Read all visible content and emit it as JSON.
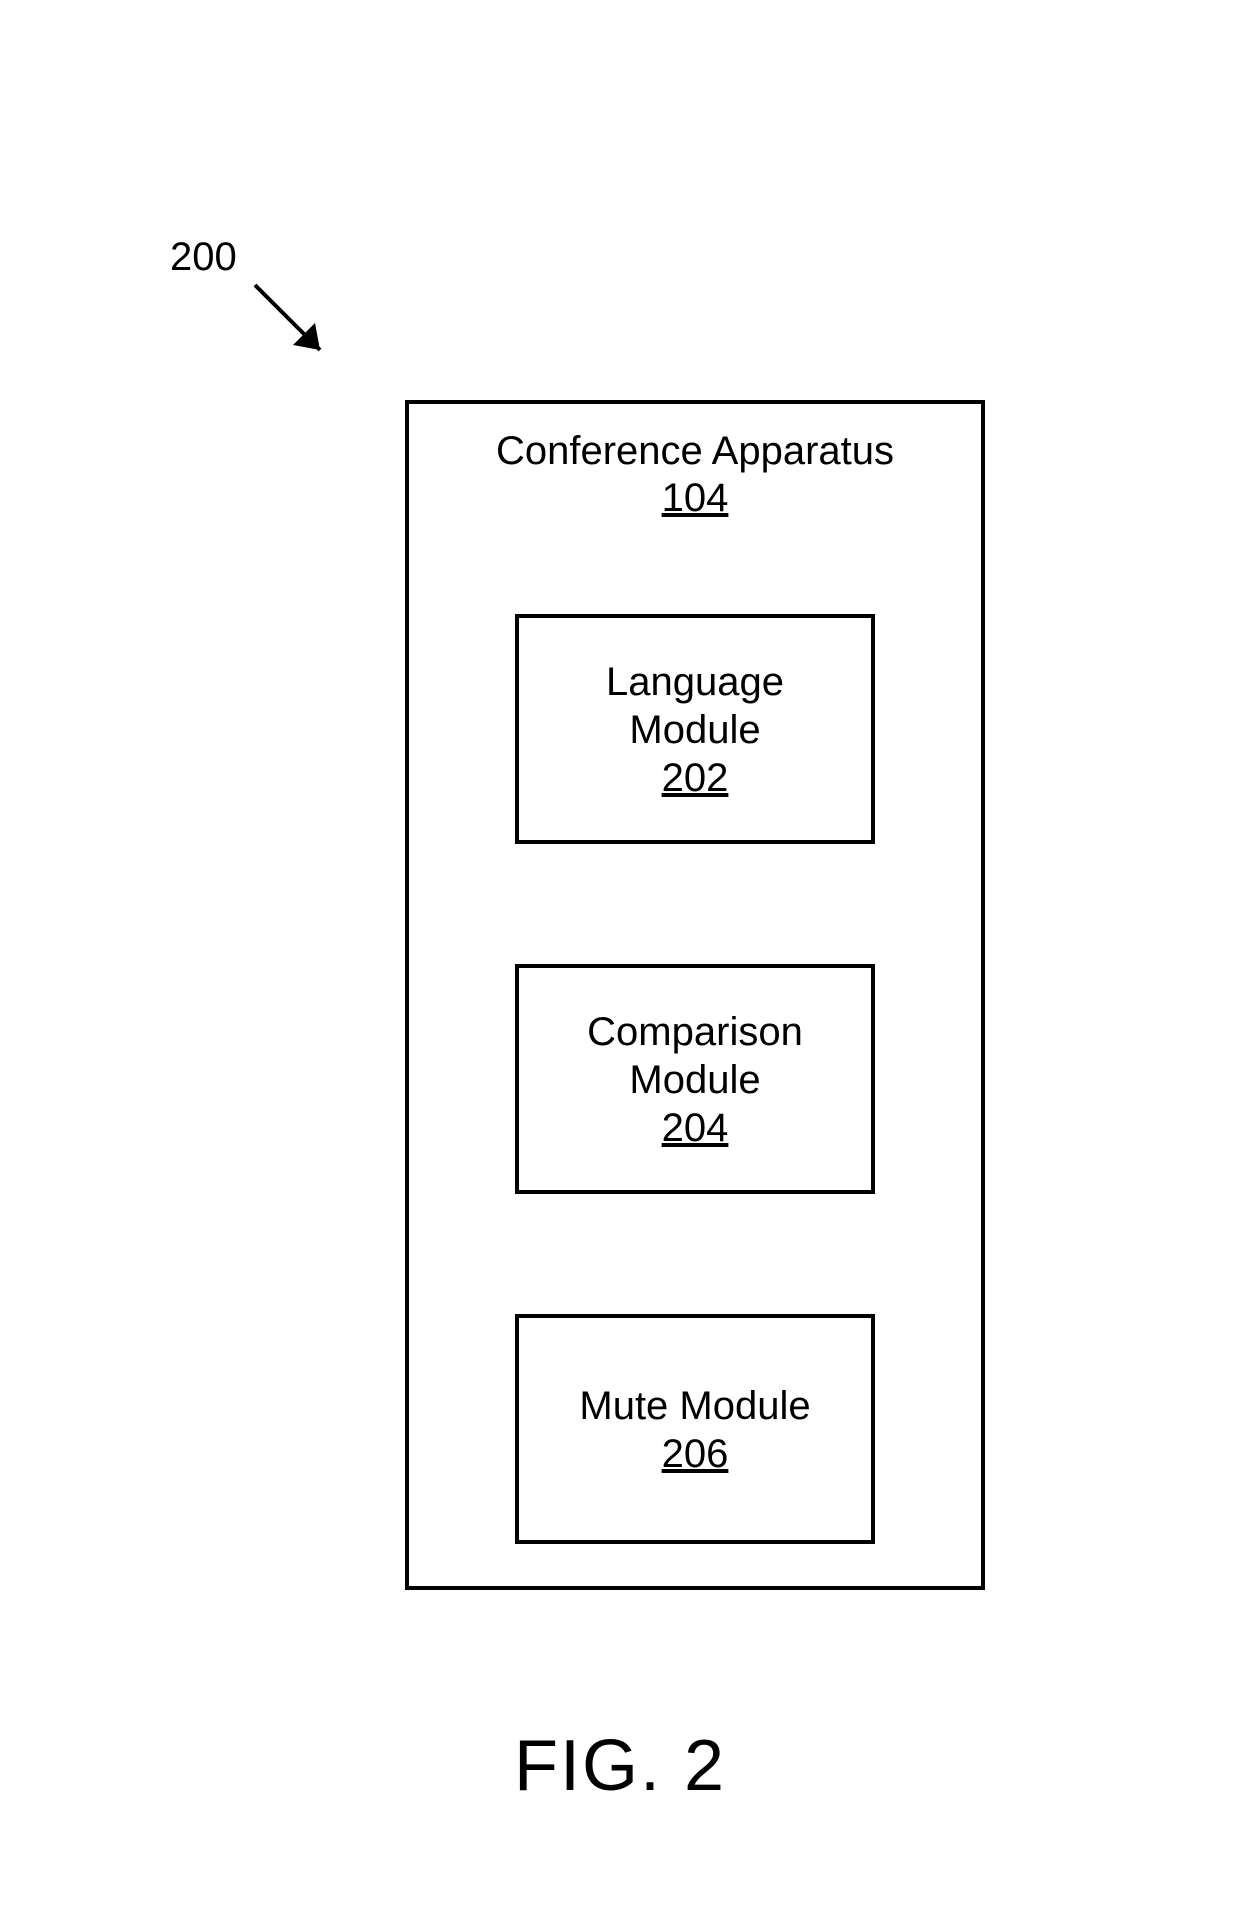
{
  "reference_label": "200",
  "outer_box": {
    "title": "Conference Apparatus",
    "number": "104"
  },
  "modules": [
    {
      "title_line1": "Language",
      "title_line2": "Module",
      "number": "202"
    },
    {
      "title_line1": "Comparison",
      "title_line2": "Module",
      "number": "204"
    },
    {
      "title_line1": "Mute Module",
      "title_line2": "",
      "number": "206"
    }
  ],
  "figure_caption": "FIG. 2"
}
